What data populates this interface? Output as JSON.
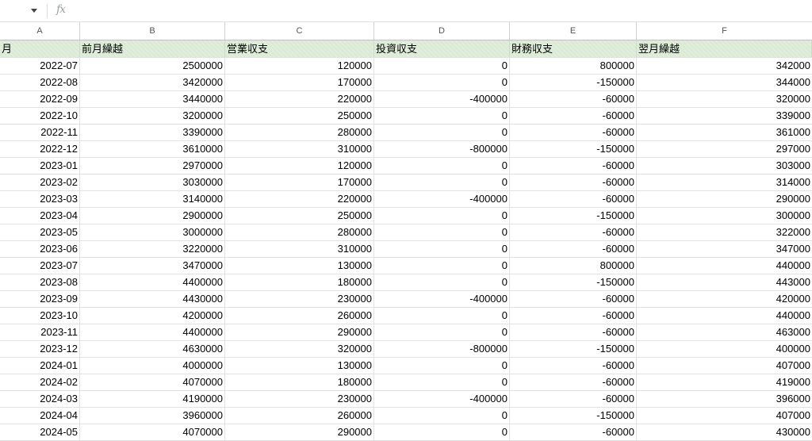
{
  "formula_bar": {
    "fx_label": "fx",
    "icons": [
      "namebox-dropdown-icon",
      "fx-icon"
    ]
  },
  "columns": [
    "A",
    "B",
    "C",
    "D",
    "E",
    "F"
  ],
  "header_row": [
    "月",
    "前月繰越",
    "営業収支",
    "投資収支",
    "財務収支",
    "翌月繰越"
  ],
  "rows": [
    [
      "2022-07",
      "2500000",
      "120000",
      "0",
      "800000",
      "342000"
    ],
    [
      "2022-08",
      "3420000",
      "170000",
      "0",
      "-150000",
      "344000"
    ],
    [
      "2022-09",
      "3440000",
      "220000",
      "-400000",
      "-60000",
      "320000"
    ],
    [
      "2022-10",
      "3200000",
      "250000",
      "0",
      "-60000",
      "339000"
    ],
    [
      "2022-11",
      "3390000",
      "280000",
      "0",
      "-60000",
      "361000"
    ],
    [
      "2022-12",
      "3610000",
      "310000",
      "-800000",
      "-150000",
      "297000"
    ],
    [
      "2023-01",
      "2970000",
      "120000",
      "0",
      "-60000",
      "303000"
    ],
    [
      "2023-02",
      "3030000",
      "170000",
      "0",
      "-60000",
      "314000"
    ],
    [
      "2023-03",
      "3140000",
      "220000",
      "-400000",
      "-60000",
      "290000"
    ],
    [
      "2023-04",
      "2900000",
      "250000",
      "0",
      "-150000",
      "300000"
    ],
    [
      "2023-05",
      "3000000",
      "280000",
      "0",
      "-60000",
      "322000"
    ],
    [
      "2023-06",
      "3220000",
      "310000",
      "0",
      "-60000",
      "347000"
    ],
    [
      "2023-07",
      "3470000",
      "130000",
      "0",
      "800000",
      "440000"
    ],
    [
      "2023-08",
      "4400000",
      "180000",
      "0",
      "-150000",
      "443000"
    ],
    [
      "2023-09",
      "4430000",
      "230000",
      "-400000",
      "-60000",
      "420000"
    ],
    [
      "2023-10",
      "4200000",
      "260000",
      "0",
      "-60000",
      "440000"
    ],
    [
      "2023-11",
      "4400000",
      "290000",
      "0",
      "-60000",
      "463000"
    ],
    [
      "2023-12",
      "4630000",
      "320000",
      "-800000",
      "-150000",
      "400000"
    ],
    [
      "2024-01",
      "4000000",
      "130000",
      "0",
      "-60000",
      "407000"
    ],
    [
      "2024-02",
      "4070000",
      "180000",
      "0",
      "-60000",
      "419000"
    ],
    [
      "2024-03",
      "4190000",
      "230000",
      "-400000",
      "-60000",
      "396000"
    ],
    [
      "2024-04",
      "3960000",
      "260000",
      "0",
      "-150000",
      "407000"
    ],
    [
      "2024-05",
      "4070000",
      "290000",
      "0",
      "-60000",
      "430000"
    ]
  ]
}
